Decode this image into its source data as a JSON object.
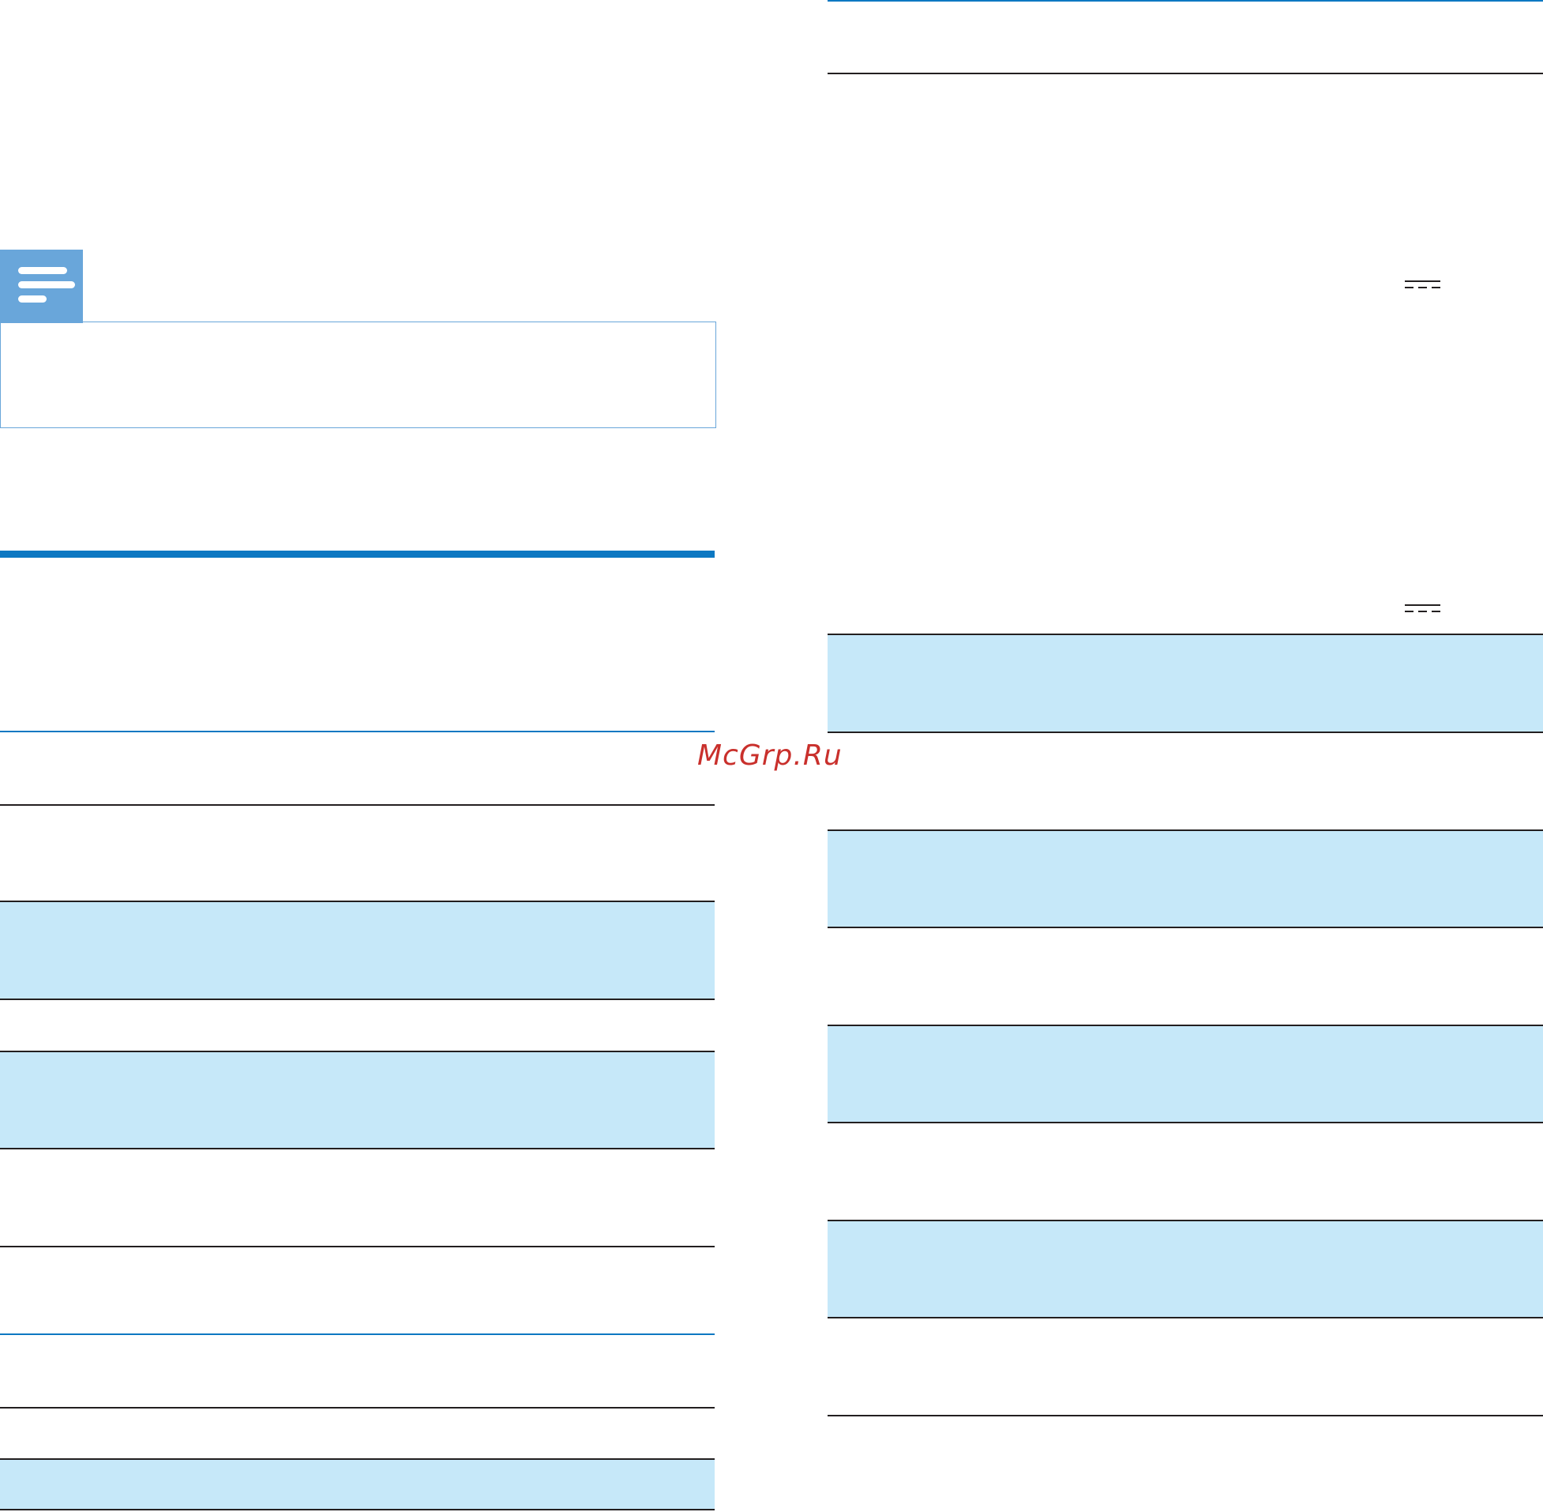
{
  "note": {
    "icon": "note-icon"
  },
  "watermark": {
    "text": "McGrp.Ru"
  },
  "colors": {
    "accent_blue": "#0d78c2",
    "note_blue": "#69a6da",
    "row_shade": "#c6e8f9",
    "rule": "#231f20",
    "watermark": "#c9302c"
  },
  "symbols": {
    "dc_symbol": "direct-current-symbol"
  }
}
